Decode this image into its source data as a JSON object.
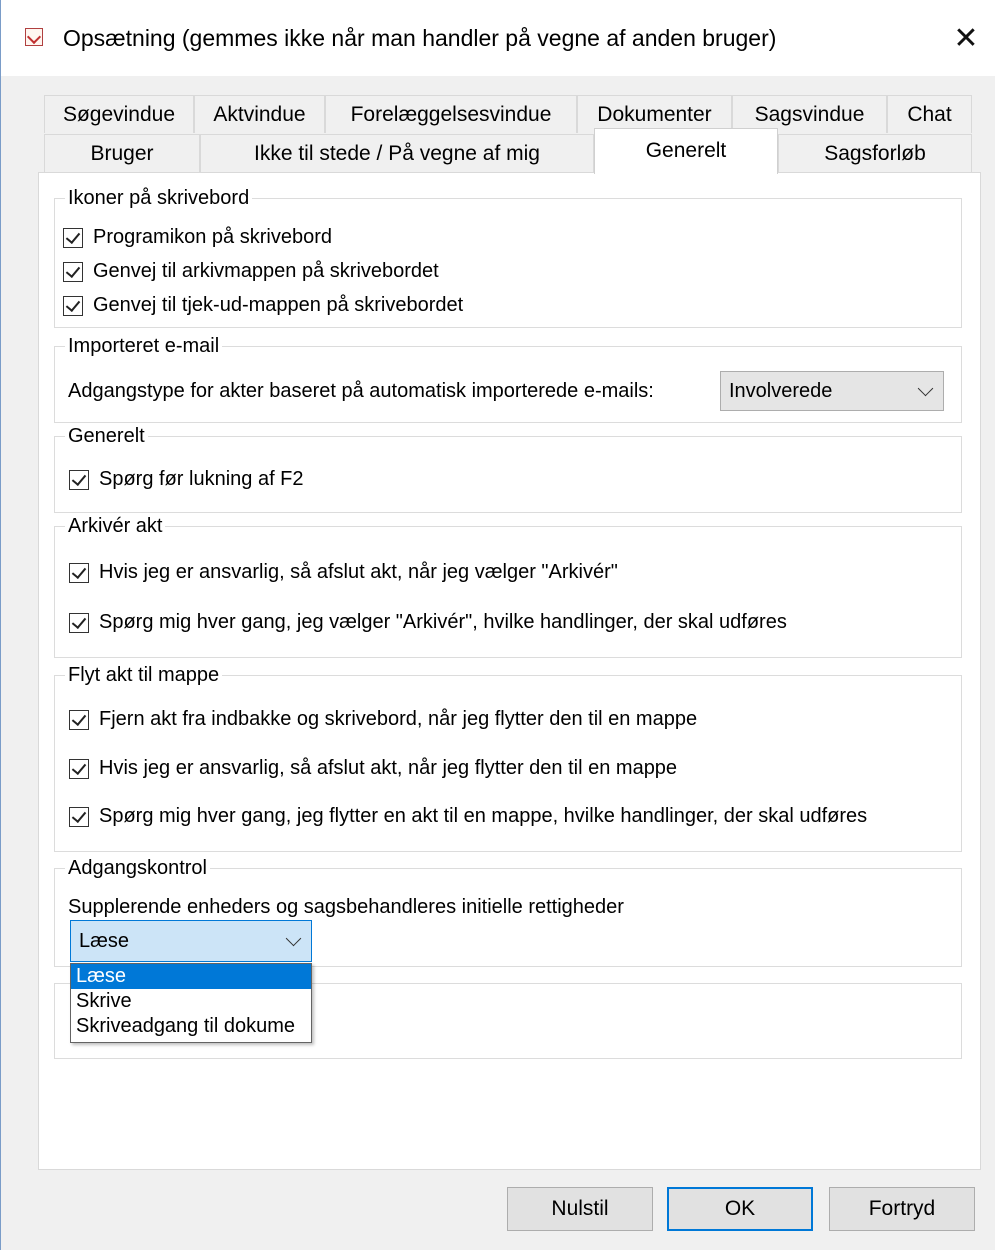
{
  "window": {
    "title": "Opsætning (gemmes ikke når man handler på vegne af anden bruger)",
    "close_symbol": "✕"
  },
  "tabs": {
    "row1": [
      "Søgevindue",
      "Aktvindue",
      "Forelæggelsesvindue",
      "Dokumenter",
      "Sagsvindue",
      "Chat"
    ],
    "row2": [
      "Bruger",
      "Ikke til stede / På vegne af mig",
      "Generelt",
      "Sagsforløb"
    ],
    "active": "Generelt"
  },
  "groups": {
    "desktop_icons": {
      "legend": "Ikoner på skrivebord",
      "items": [
        {
          "label": "Programikon på skrivebord",
          "checked": true
        },
        {
          "label": "Genvej til arkivmappen på skrivebordet",
          "checked": true
        },
        {
          "label": "Genvej til tjek-ud-mappen på skrivebordet",
          "checked": true
        }
      ]
    },
    "imported_email": {
      "legend": "Importeret e-mail",
      "label": "Adgangstype for akter baseret på automatisk importerede e-mails:",
      "value": "Involverede"
    },
    "general": {
      "legend": "Generelt",
      "items": [
        {
          "label": "Spørg før lukning af F2",
          "checked": true
        }
      ]
    },
    "archive": {
      "legend": "Arkivér akt",
      "items": [
        {
          "label": "Hvis jeg er ansvarlig, så afslut akt, når jeg vælger \"Arkivér\"",
          "checked": true
        },
        {
          "label": "Spørg mig hver gang, jeg vælger \"Arkivér\", hvilke handlinger, der skal udføres",
          "checked": true
        }
      ]
    },
    "move": {
      "legend": "Flyt akt til mappe",
      "items": [
        {
          "label": "Fjern akt fra indbakke og skrivebord, når jeg flytter den til en mappe",
          "checked": true
        },
        {
          "label": "Hvis jeg er ansvarlig, så afslut akt, når jeg flytter den til en mappe",
          "checked": true
        },
        {
          "label": "Spørg mig hver gang, jeg flytter en akt til en mappe, hvilke handlinger, der skal udføres",
          "checked": true
        }
      ]
    },
    "access": {
      "legend": "Adgangskontrol",
      "label": "Supplerende enheders og sagsbehandleres initielle rettigheder",
      "value": "Læse",
      "options": [
        "Læse",
        "Skrive",
        "Skriveadgang til dokume"
      ]
    }
  },
  "buttons": {
    "reset": "Nulstil",
    "ok": "OK",
    "cancel": "Fortryd"
  },
  "colors": {
    "accent": "#0078d7",
    "select_bg": "#cce4f7"
  }
}
